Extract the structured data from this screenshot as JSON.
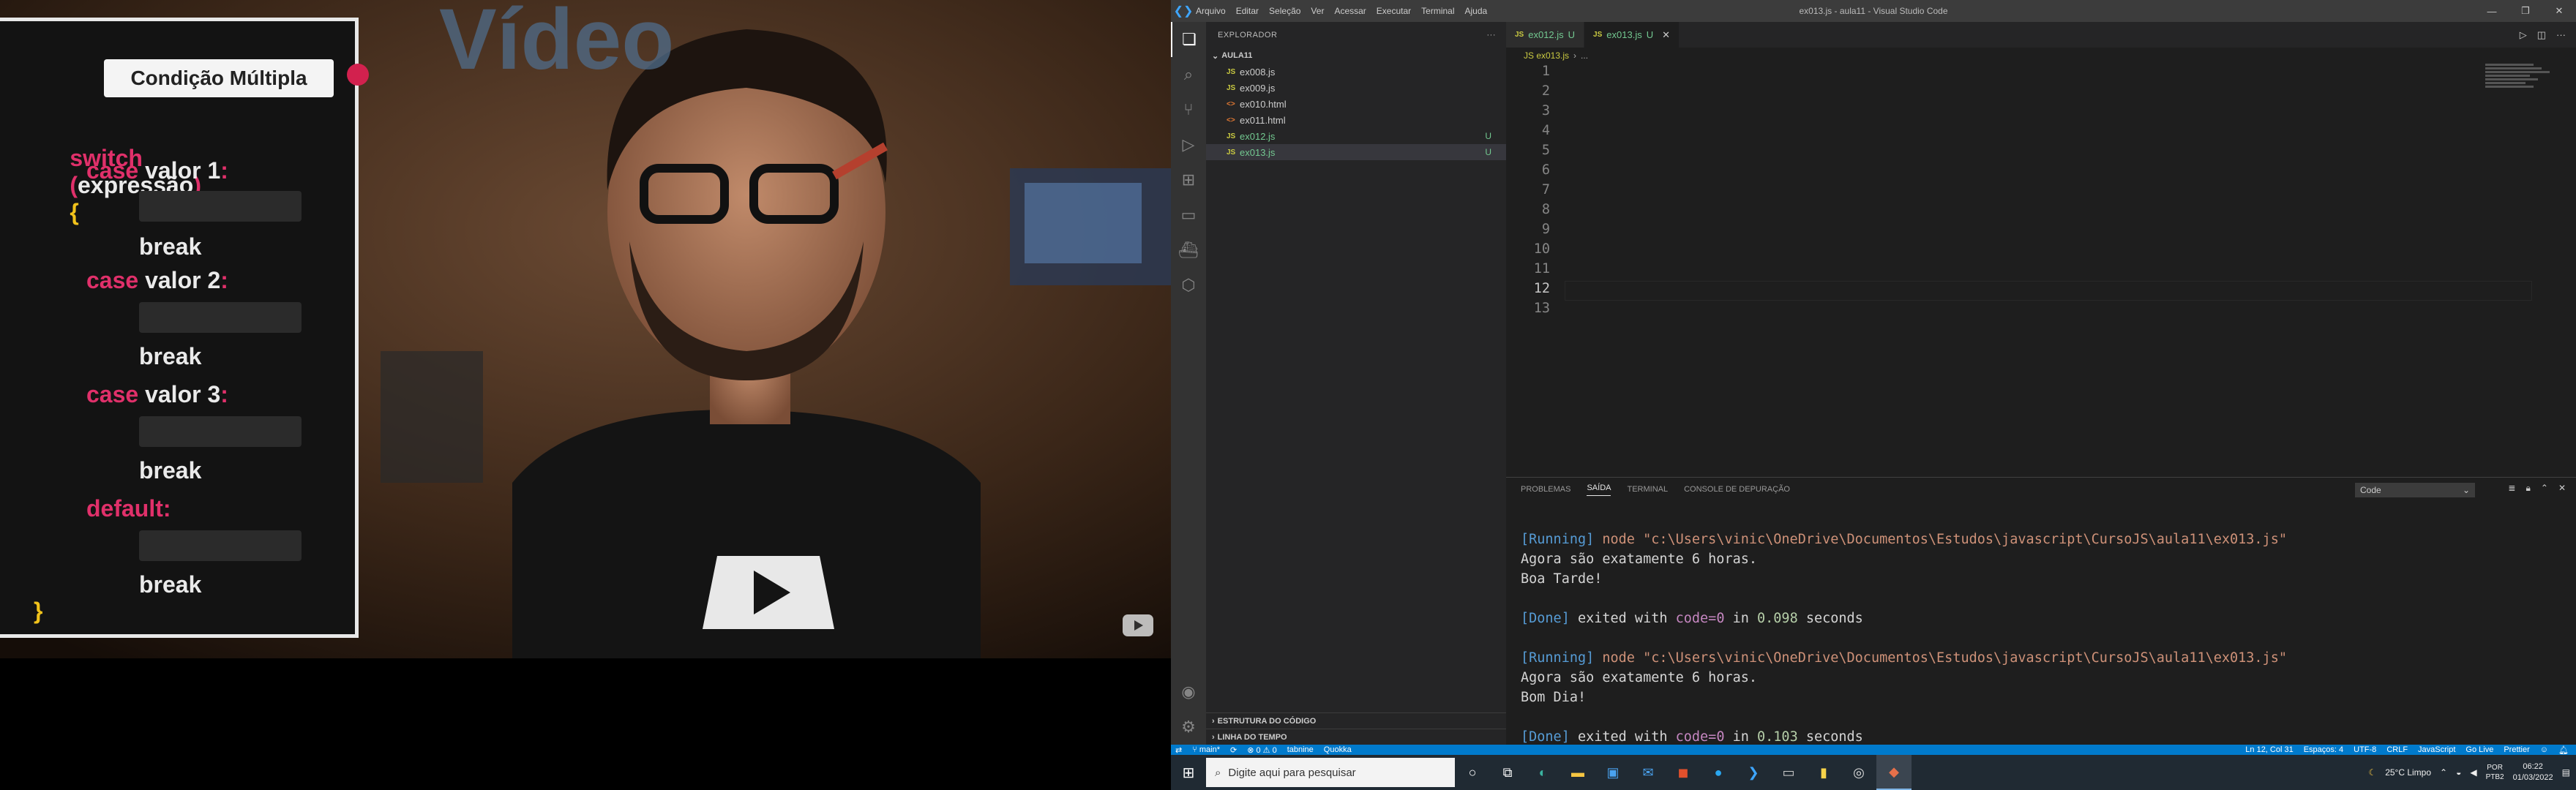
{
  "video": {
    "slide_title": "Condição Múltipla",
    "code": {
      "switch_kw": "switch",
      "paren_open": "(",
      "expr": "expressão",
      "paren_close": ")",
      "brace_open": "{",
      "cases": [
        {
          "kw": "case",
          "label": "valor 1",
          "colon": ":",
          "break": "break"
        },
        {
          "kw": "case",
          "label": "valor 2",
          "colon": ":",
          "break": "break"
        },
        {
          "kw": "case",
          "label": "valor 3",
          "colon": ":",
          "break": "break"
        }
      ],
      "default_kw": "default:",
      "default_break": "break",
      "brace_close": "}"
    },
    "background_sign": "Vídeo",
    "accent_color": "#e0306a"
  },
  "vscode": {
    "menu": [
      "Arquivo",
      "Editar",
      "Seleção",
      "Ver",
      "Acessar",
      "Executar",
      "Terminal",
      "Ajuda"
    ],
    "window_title": "ex013.js - aula11 - Visual Studio Code",
    "explorer": {
      "title": "EXPLORADOR",
      "folder": "AULA11",
      "files": [
        {
          "icon": "JS",
          "name": "ex008.js",
          "badge": ""
        },
        {
          "icon": "JS",
          "name": "ex009.js",
          "badge": ""
        },
        {
          "icon": "<>",
          "name": "ex010.html",
          "badge": ""
        },
        {
          "icon": "<>",
          "name": "ex011.html",
          "badge": ""
        },
        {
          "icon": "JS",
          "name": "ex012.js",
          "badge": "U"
        },
        {
          "icon": "JS",
          "name": "ex013.js",
          "badge": "U"
        }
      ],
      "outline": "ESTRUTURA DO CÓDIGO",
      "timeline": "LINHA DO TEMPO"
    },
    "tabs": [
      {
        "icon": "JS",
        "name": "ex012.js",
        "badge": "U"
      },
      {
        "icon": "JS",
        "name": "ex013.js",
        "badge": "U"
      }
    ],
    "breadcrumb": [
      "JS ex013.js",
      "..."
    ],
    "line_numbers": [
      "1",
      "2",
      "3",
      "4",
      "5",
      "6",
      "7",
      "8",
      "9",
      "10",
      "11",
      "12",
      "13"
    ],
    "current_line": "12",
    "panel": {
      "tabs": [
        "PROBLEMAS",
        "SAÍDA",
        "TERMINAL",
        "CONSOLE DE DEPURAÇÃO"
      ],
      "active_tab": "SAÍDA",
      "channel": "Code",
      "output": [
        {
          "run": "[Running]",
          "cmd": " node \"c:\\Users\\vinic\\OneDrive\\Documentos\\Estudos\\javascript\\CursoJS\\aula11\\ex013.js\""
        },
        {
          "text": "Agora são exatamente 6 horas."
        },
        {
          "text": "Boa Tarde!"
        },
        {
          "text": ""
        },
        {
          "done": "[Done]",
          "msg": " exited with ",
          "code": "code=0",
          "in": " in ",
          "time": "0.098",
          "unit": " seconds"
        },
        {
          "text": ""
        },
        {
          "run": "[Running]",
          "cmd": " node \"c:\\Users\\vinic\\OneDrive\\Documentos\\Estudos\\javascript\\CursoJS\\aula11\\ex013.js\""
        },
        {
          "text": "Agora são exatamente 6 horas."
        },
        {
          "text": "Bom Dia!"
        },
        {
          "text": ""
        },
        {
          "done": "[Done]",
          "msg": " exited with ",
          "code": "code=0",
          "in": " in ",
          "time": "0.103",
          "unit": " seconds"
        }
      ]
    },
    "status": {
      "branch": "main*",
      "errors": "⊗ 0 ⚠ 0",
      "tabnine": "tabnine",
      "quokka": "Quokka",
      "position": "Ln 12, Col 31",
      "spaces": "Espaços: 4",
      "encoding": "UTF-8",
      "eol": "CRLF",
      "language": "JavaScript",
      "golive": "Go Live",
      "prettier": "Prettier"
    },
    "status_color": "#007acc"
  },
  "taskbar": {
    "search_placeholder": "Digite aqui para pesquisar",
    "weather": "25°C  Limpo",
    "lang_line1": "POR",
    "lang_line2": "PTB2",
    "time": "06:22",
    "date": "01/03/2022"
  }
}
